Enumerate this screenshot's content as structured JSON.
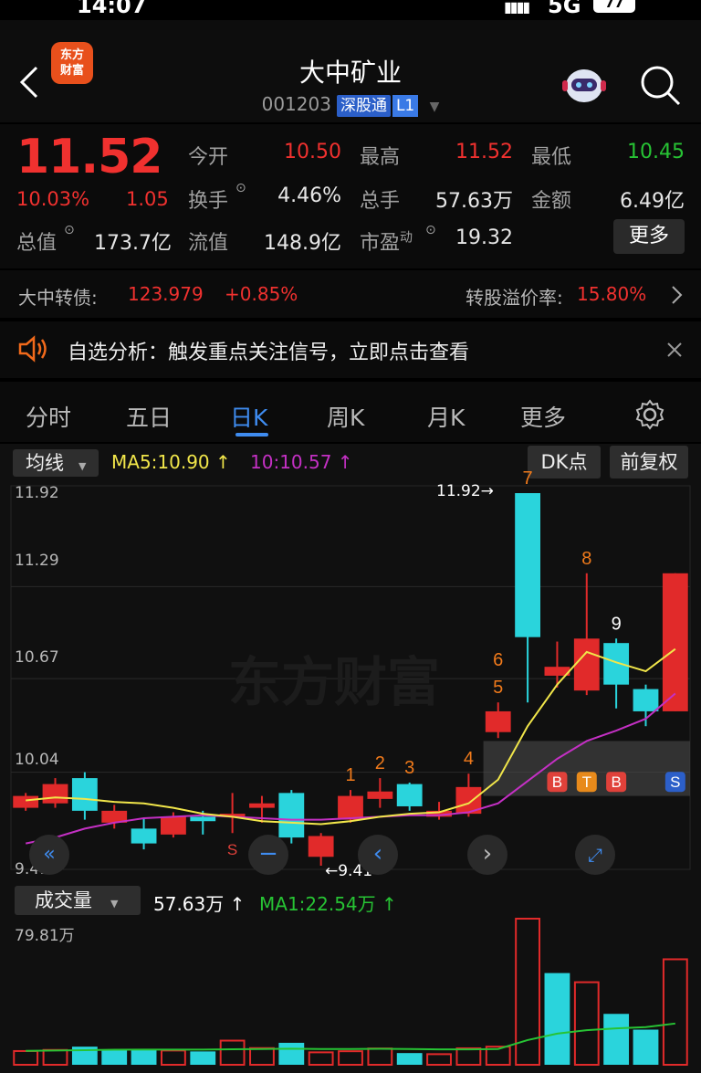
{
  "status": {
    "time": "14:07",
    "network": "5G",
    "battery": "77"
  },
  "header": {
    "logo_line1": "东方",
    "logo_line2": "财富",
    "title": "大中矿业",
    "code": "001203",
    "badge": "深股通",
    "level": "L1"
  },
  "quote": {
    "price": "11.52",
    "change_pct": "10.03%",
    "change": "1.05",
    "open_label": "今开",
    "open": "10.50",
    "high_label": "最高",
    "high": "11.52",
    "low_label": "最低",
    "low": "10.45",
    "turnover_label": "换手",
    "turnover": "4.46%",
    "volume_label": "总手",
    "volume": "57.63万",
    "amount_label": "金额",
    "amount": "6.49亿",
    "mktcap_label": "总值",
    "mktcap": "173.7亿",
    "float_label": "流值",
    "float": "148.9亿",
    "pe_label": "市盈",
    "pe_sup": "动",
    "pe": "19.32",
    "more": "更多"
  },
  "bond": {
    "name": "大中转债:",
    "price": "123.979",
    "change": "+0.85%",
    "premium_label": "转股溢价率:",
    "premium": "15.80%"
  },
  "notice": {
    "text": "自选分析：触发重点关注信号，立即点击查看"
  },
  "tabs": [
    "分时",
    "五日",
    "日K",
    "周K",
    "月K",
    "更多"
  ],
  "active_tab": "日K",
  "chart_toolbar": {
    "ma_select": "均线",
    "ma5": "MA5:10.90 ↑",
    "ma10": "10:10.57 ↑",
    "dk": "DK点",
    "fq": "前复权"
  },
  "price_axis": [
    "11.92",
    "11.29",
    "10.67",
    "10.04",
    "9.41"
  ],
  "watermark": "东方财富",
  "annotations": {
    "high": "11.92→",
    "low": "←9.41"
  },
  "volume_toolbar": {
    "select": "成交量",
    "value": "57.63万 ↑",
    "ma1": "MA1:22.54万 ↑",
    "axis_max": "79.81万"
  },
  "colors": {
    "up": "#e12a2a",
    "down": "#2ad4dc",
    "ma5": "#f1e64a",
    "ma10": "#c430c4",
    "accent": "#3a7ae6"
  },
  "chart_data": {
    "type": "candlestick",
    "ylim": [
      9.41,
      11.92
    ],
    "candles": [
      {
        "o": 9.88,
        "c": 9.8,
        "h": 9.9,
        "l": 9.78,
        "dir": "up"
      },
      {
        "o": 9.83,
        "c": 9.96,
        "h": 10.0,
        "l": 9.8,
        "dir": "up"
      },
      {
        "o": 10.0,
        "c": 9.78,
        "h": 10.04,
        "l": 9.72,
        "dir": "down"
      },
      {
        "o": 9.7,
        "c": 9.78,
        "h": 9.82,
        "l": 9.66,
        "dir": "up"
      },
      {
        "o": 9.66,
        "c": 9.56,
        "h": 9.73,
        "l": 9.52,
        "dir": "down"
      },
      {
        "o": 9.62,
        "c": 9.74,
        "h": 9.77,
        "l": 9.6,
        "dir": "up"
      },
      {
        "o": 9.74,
        "c": 9.71,
        "h": 9.78,
        "l": 9.62,
        "dir": "down"
      },
      {
        "o": 9.74,
        "c": 9.76,
        "h": 9.9,
        "l": 9.63,
        "dir": "up"
      },
      {
        "o": 9.8,
        "c": 9.83,
        "h": 9.88,
        "l": 9.7,
        "dir": "up"
      },
      {
        "o": 9.9,
        "c": 9.6,
        "h": 9.92,
        "l": 9.56,
        "dir": "down"
      },
      {
        "o": 9.47,
        "c": 9.61,
        "h": 9.63,
        "l": 9.41,
        "dir": "up"
      },
      {
        "o": 9.72,
        "c": 9.88,
        "h": 9.92,
        "l": 9.7,
        "dir": "up"
      },
      {
        "o": 9.86,
        "c": 9.91,
        "h": 10.0,
        "l": 9.8,
        "dir": "up"
      },
      {
        "o": 9.96,
        "c": 9.81,
        "h": 9.97,
        "l": 9.78,
        "dir": "down"
      },
      {
        "o": 9.74,
        "c": 9.78,
        "h": 9.84,
        "l": 9.72,
        "dir": "up"
      },
      {
        "o": 9.76,
        "c": 9.94,
        "h": 10.03,
        "l": 9.74,
        "dir": "up"
      },
      {
        "o": 10.31,
        "c": 10.45,
        "h": 10.51,
        "l": 10.27,
        "dir": "up"
      },
      {
        "o": 11.92,
        "c": 10.95,
        "h": 11.92,
        "l": 10.51,
        "dir": "down"
      },
      {
        "o": 10.69,
        "c": 10.75,
        "h": 10.92,
        "l": 10.61,
        "dir": "up"
      },
      {
        "o": 10.59,
        "c": 10.94,
        "h": 11.38,
        "l": 10.56,
        "dir": "up"
      },
      {
        "o": 10.91,
        "c": 10.63,
        "h": 10.94,
        "l": 10.47,
        "dir": "down"
      },
      {
        "o": 10.6,
        "c": 10.45,
        "h": 10.63,
        "l": 10.35,
        "dir": "down"
      },
      {
        "o": 10.45,
        "c": 11.38,
        "h": 11.38,
        "l": 10.45,
        "dir": "up"
      }
    ],
    "ma5": [
      9.85,
      9.87,
      9.86,
      9.84,
      9.83,
      9.8,
      9.76,
      9.74,
      9.71,
      9.7,
      9.69,
      9.71,
      9.74,
      9.76,
      9.77,
      9.83,
      9.99,
      10.35,
      10.63,
      10.85,
      10.78,
      10.72,
      10.87
    ],
    "ma10": [
      9.56,
      9.6,
      9.66,
      9.7,
      9.73,
      9.74,
      9.75,
      9.74,
      9.73,
      9.72,
      9.72,
      9.73,
      9.74,
      9.75,
      9.75,
      9.77,
      9.83,
      9.98,
      10.13,
      10.25,
      10.32,
      10.4,
      10.57
    ],
    "volume_ylim": [
      0,
      79.81
    ],
    "volumes": [
      {
        "v": 7.5,
        "dir": "up"
      },
      {
        "v": 8.1,
        "dir": "up"
      },
      {
        "v": 9.9,
        "dir": "down"
      },
      {
        "v": 8.4,
        "dir": "down"
      },
      {
        "v": 8.1,
        "dir": "down"
      },
      {
        "v": 7.8,
        "dir": "up"
      },
      {
        "v": 7.3,
        "dir": "down"
      },
      {
        "v": 13.2,
        "dir": "up"
      },
      {
        "v": 9.1,
        "dir": "up"
      },
      {
        "v": 12.0,
        "dir": "down"
      },
      {
        "v": 6.8,
        "dir": "up"
      },
      {
        "v": 7.4,
        "dir": "up"
      },
      {
        "v": 8.9,
        "dir": "up"
      },
      {
        "v": 6.4,
        "dir": "down"
      },
      {
        "v": 5.8,
        "dir": "up"
      },
      {
        "v": 9.0,
        "dir": "up"
      },
      {
        "v": 9.9,
        "dir": "up"
      },
      {
        "v": 79.81,
        "dir": "up"
      },
      {
        "v": 50.1,
        "dir": "down"
      },
      {
        "v": 45.1,
        "dir": "up"
      },
      {
        "v": 27.8,
        "dir": "down"
      },
      {
        "v": 19.2,
        "dir": "down"
      },
      {
        "v": 57.63,
        "dir": "up"
      }
    ],
    "volume_ma1": [
      7.6,
      7.8,
      8.0,
      8.2,
      8.3,
      8.3,
      8.3,
      8.5,
      8.6,
      8.8,
      8.6,
      8.6,
      8.7,
      8.6,
      8.4,
      8.4,
      8.6,
      13.5,
      17.0,
      18.9,
      19.9,
      20.6,
      22.54
    ],
    "markers": [
      {
        "i": 11,
        "t": "1"
      },
      {
        "i": 12,
        "t": "2"
      },
      {
        "i": 13,
        "t": "3"
      },
      {
        "i": 15,
        "t": "4"
      },
      {
        "i": 16,
        "t": "5"
      },
      {
        "i": 16,
        "t": "6"
      },
      {
        "i": 17,
        "t": "7"
      },
      {
        "i": 19,
        "t": "8"
      },
      {
        "i": 20,
        "t": "9"
      }
    ],
    "signals": [
      {
        "i": 7,
        "t": "S"
      },
      {
        "i": 18,
        "t": "B"
      },
      {
        "i": 19,
        "t": "T"
      },
      {
        "i": 20,
        "t": "B"
      },
      {
        "i": 22,
        "t": "S"
      }
    ]
  }
}
